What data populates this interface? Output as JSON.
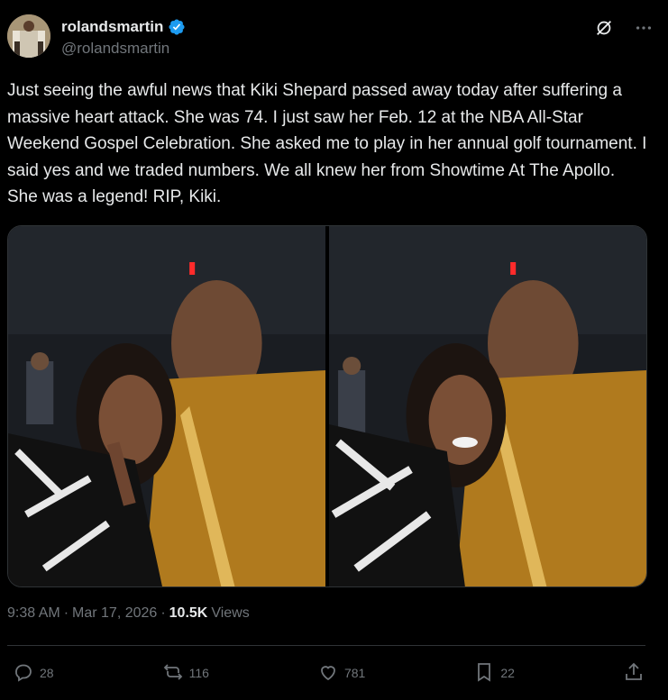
{
  "author": {
    "display_name": "rolandsmartin",
    "handle": "@rolandsmartin",
    "verified": true
  },
  "tweet": {
    "text": "Just seeing the awful news that Kiki Shepard passed away today after suffering a massive heart attack. She was 74. I just saw her Feb. 12 at the NBA All-Star Weekend Gospel Celebration. She asked me to play in her annual golf tournament. I said yes and we traded numbers. We all knew her from Showtime At The Apollo. She was a legend! RIP, Kiki.",
    "time": "9:38 AM",
    "separator": "·",
    "date": "Mar 17, 2026",
    "views_count": "10.5K",
    "views_label": "Views"
  },
  "actions": {
    "replies": "28",
    "reposts": "116",
    "likes": "781",
    "bookmarks": "22"
  },
  "icons": {
    "top_right": [
      "grok-icon",
      "more-icon"
    ],
    "actions": [
      "reply-icon",
      "repost-icon",
      "like-icon",
      "bookmark-icon",
      "share-icon"
    ]
  },
  "colors": {
    "background": "#000000",
    "text": "#e7e9ea",
    "secondary": "#71767b",
    "verified": "#1d9bf0",
    "border": "#2f3336"
  }
}
